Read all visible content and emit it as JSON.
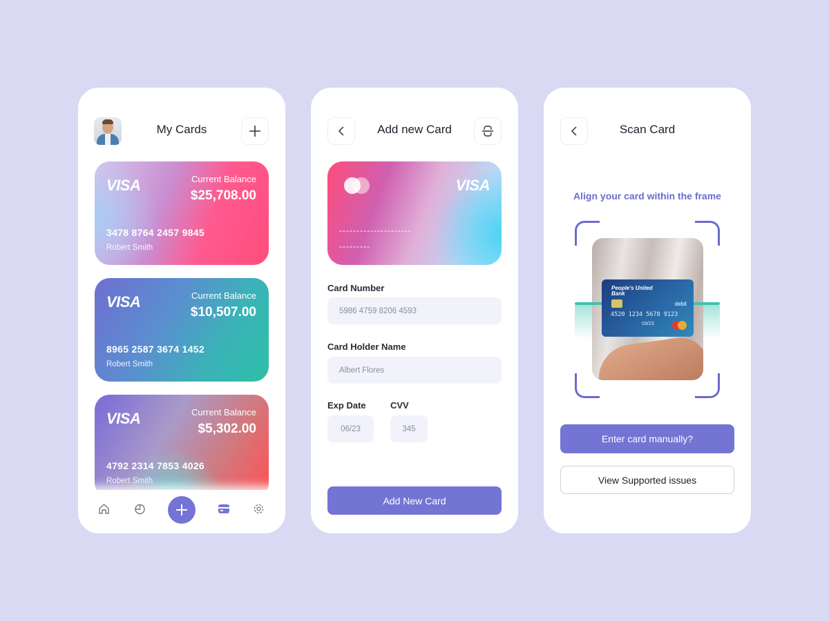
{
  "colors": {
    "background": "#d9d9f3",
    "accent": "#7474d4",
    "accent_text": "#6b6bd0"
  },
  "my_cards": {
    "title": "My Cards",
    "add_icon": "plus-icon",
    "cards": [
      {
        "brand": "VISA",
        "balance_label": "Current Balance",
        "balance": "$25,708.00",
        "number": "3478 8764 2457 9845",
        "holder": "Robert Smith"
      },
      {
        "brand": "VISA",
        "balance_label": "Current Balance",
        "balance": "$10,507.00",
        "number": "8965 2587 3674 1452",
        "holder": "Robert Smith"
      },
      {
        "brand": "VISA",
        "balance_label": "Current Balance",
        "balance": "$5,302.00",
        "number": "4792 2314 7853 4026",
        "holder": "Robert Smith"
      }
    ],
    "nav": [
      "home-icon",
      "chart-icon",
      "plus-icon",
      "card-icon",
      "gear-icon"
    ],
    "nav_active": "card-icon"
  },
  "add_card": {
    "title": "Add new Card",
    "preview": {
      "brand": "VISA",
      "number_placeholder": "---------------------",
      "name_placeholder": "---------"
    },
    "fields": {
      "card_number_label": "Card Number",
      "card_number_value": "5986 4759 8206 4593",
      "holder_label": "Card Holder Name",
      "holder_value": "Albert Flores",
      "exp_label": "Exp Date",
      "exp_value": "06/23",
      "cvv_label": "CVV",
      "cvv_value": "345"
    },
    "submit": "Add New Card"
  },
  "scan_card": {
    "title": "Scan Card",
    "instruction": "Align your card within the frame",
    "photo_card": {
      "bank": "People's United Bank",
      "type": "debit",
      "number": "4520 1234 5678 9123",
      "exp": "03/23"
    },
    "manual_button": "Enter card manually?",
    "supported_button": "View Supported issues"
  }
}
